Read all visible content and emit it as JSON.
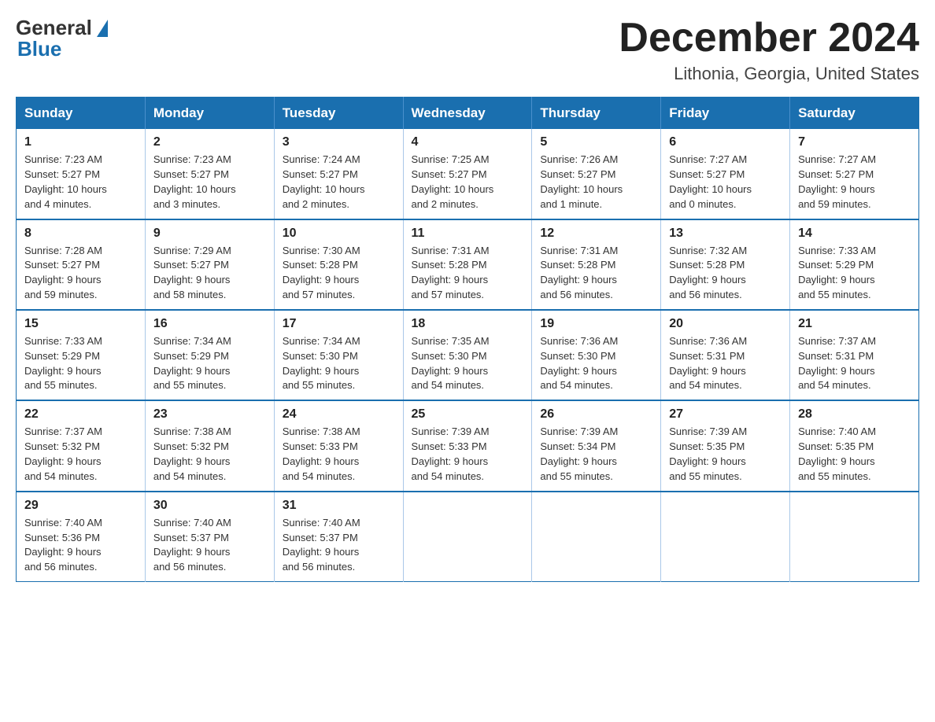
{
  "logo": {
    "general": "General",
    "blue": "Blue"
  },
  "title": "December 2024",
  "location": "Lithonia, Georgia, United States",
  "days_of_week": [
    "Sunday",
    "Monday",
    "Tuesday",
    "Wednesday",
    "Thursday",
    "Friday",
    "Saturday"
  ],
  "weeks": [
    [
      {
        "day": "1",
        "info": "Sunrise: 7:23 AM\nSunset: 5:27 PM\nDaylight: 10 hours\nand 4 minutes."
      },
      {
        "day": "2",
        "info": "Sunrise: 7:23 AM\nSunset: 5:27 PM\nDaylight: 10 hours\nand 3 minutes."
      },
      {
        "day": "3",
        "info": "Sunrise: 7:24 AM\nSunset: 5:27 PM\nDaylight: 10 hours\nand 2 minutes."
      },
      {
        "day": "4",
        "info": "Sunrise: 7:25 AM\nSunset: 5:27 PM\nDaylight: 10 hours\nand 2 minutes."
      },
      {
        "day": "5",
        "info": "Sunrise: 7:26 AM\nSunset: 5:27 PM\nDaylight: 10 hours\nand 1 minute."
      },
      {
        "day": "6",
        "info": "Sunrise: 7:27 AM\nSunset: 5:27 PM\nDaylight: 10 hours\nand 0 minutes."
      },
      {
        "day": "7",
        "info": "Sunrise: 7:27 AM\nSunset: 5:27 PM\nDaylight: 9 hours\nand 59 minutes."
      }
    ],
    [
      {
        "day": "8",
        "info": "Sunrise: 7:28 AM\nSunset: 5:27 PM\nDaylight: 9 hours\nand 59 minutes."
      },
      {
        "day": "9",
        "info": "Sunrise: 7:29 AM\nSunset: 5:27 PM\nDaylight: 9 hours\nand 58 minutes."
      },
      {
        "day": "10",
        "info": "Sunrise: 7:30 AM\nSunset: 5:28 PM\nDaylight: 9 hours\nand 57 minutes."
      },
      {
        "day": "11",
        "info": "Sunrise: 7:31 AM\nSunset: 5:28 PM\nDaylight: 9 hours\nand 57 minutes."
      },
      {
        "day": "12",
        "info": "Sunrise: 7:31 AM\nSunset: 5:28 PM\nDaylight: 9 hours\nand 56 minutes."
      },
      {
        "day": "13",
        "info": "Sunrise: 7:32 AM\nSunset: 5:28 PM\nDaylight: 9 hours\nand 56 minutes."
      },
      {
        "day": "14",
        "info": "Sunrise: 7:33 AM\nSunset: 5:29 PM\nDaylight: 9 hours\nand 55 minutes."
      }
    ],
    [
      {
        "day": "15",
        "info": "Sunrise: 7:33 AM\nSunset: 5:29 PM\nDaylight: 9 hours\nand 55 minutes."
      },
      {
        "day": "16",
        "info": "Sunrise: 7:34 AM\nSunset: 5:29 PM\nDaylight: 9 hours\nand 55 minutes."
      },
      {
        "day": "17",
        "info": "Sunrise: 7:34 AM\nSunset: 5:30 PM\nDaylight: 9 hours\nand 55 minutes."
      },
      {
        "day": "18",
        "info": "Sunrise: 7:35 AM\nSunset: 5:30 PM\nDaylight: 9 hours\nand 54 minutes."
      },
      {
        "day": "19",
        "info": "Sunrise: 7:36 AM\nSunset: 5:30 PM\nDaylight: 9 hours\nand 54 minutes."
      },
      {
        "day": "20",
        "info": "Sunrise: 7:36 AM\nSunset: 5:31 PM\nDaylight: 9 hours\nand 54 minutes."
      },
      {
        "day": "21",
        "info": "Sunrise: 7:37 AM\nSunset: 5:31 PM\nDaylight: 9 hours\nand 54 minutes."
      }
    ],
    [
      {
        "day": "22",
        "info": "Sunrise: 7:37 AM\nSunset: 5:32 PM\nDaylight: 9 hours\nand 54 minutes."
      },
      {
        "day": "23",
        "info": "Sunrise: 7:38 AM\nSunset: 5:32 PM\nDaylight: 9 hours\nand 54 minutes."
      },
      {
        "day": "24",
        "info": "Sunrise: 7:38 AM\nSunset: 5:33 PM\nDaylight: 9 hours\nand 54 minutes."
      },
      {
        "day": "25",
        "info": "Sunrise: 7:39 AM\nSunset: 5:33 PM\nDaylight: 9 hours\nand 54 minutes."
      },
      {
        "day": "26",
        "info": "Sunrise: 7:39 AM\nSunset: 5:34 PM\nDaylight: 9 hours\nand 55 minutes."
      },
      {
        "day": "27",
        "info": "Sunrise: 7:39 AM\nSunset: 5:35 PM\nDaylight: 9 hours\nand 55 minutes."
      },
      {
        "day": "28",
        "info": "Sunrise: 7:40 AM\nSunset: 5:35 PM\nDaylight: 9 hours\nand 55 minutes."
      }
    ],
    [
      {
        "day": "29",
        "info": "Sunrise: 7:40 AM\nSunset: 5:36 PM\nDaylight: 9 hours\nand 56 minutes."
      },
      {
        "day": "30",
        "info": "Sunrise: 7:40 AM\nSunset: 5:37 PM\nDaylight: 9 hours\nand 56 minutes."
      },
      {
        "day": "31",
        "info": "Sunrise: 7:40 AM\nSunset: 5:37 PM\nDaylight: 9 hours\nand 56 minutes."
      },
      null,
      null,
      null,
      null
    ]
  ]
}
